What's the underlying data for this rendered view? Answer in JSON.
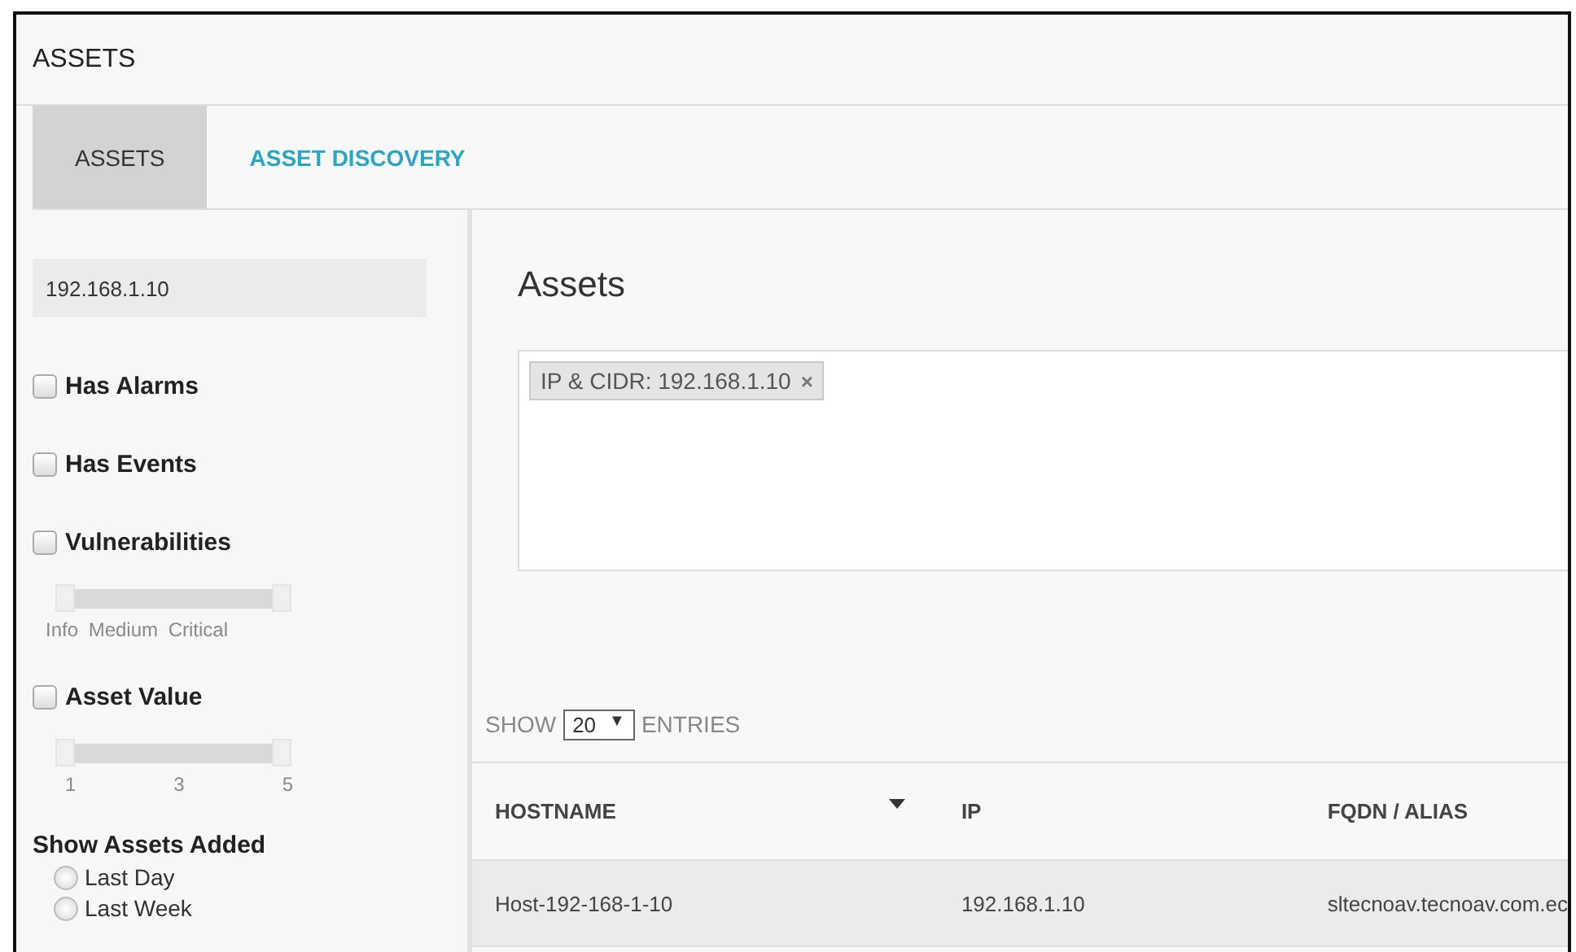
{
  "window": {
    "title": "ASSETS"
  },
  "tabs": [
    {
      "label": "ASSETS",
      "selected": true
    },
    {
      "label": "ASSET DISCOVERY",
      "selected": false
    }
  ],
  "sidebar": {
    "search": {
      "value": "192.168.1.10"
    },
    "filters": [
      {
        "kind": "checkbox",
        "label": "Has Alarms",
        "checked": false
      },
      {
        "kind": "checkbox",
        "label": "Has Events",
        "checked": false
      },
      {
        "kind": "slider",
        "label": "Vulnerabilities",
        "checked": false,
        "level": 1,
        "ticks": [
          "Info",
          "Medium",
          "Critical"
        ]
      },
      {
        "kind": "slider",
        "label": "Asset Value",
        "checked": false,
        "level": 1,
        "ticks": [
          "1",
          "3",
          "5"
        ]
      }
    ],
    "added": {
      "title": "Show Assets Added",
      "options": [
        {
          "label": "Last Day",
          "selected": false
        },
        {
          "label": "Last Week",
          "selected": false
        }
      ]
    }
  },
  "main": {
    "title": "Assets",
    "tags": [
      {
        "label": "IP & CIDR: 192.168.1.10",
        "remove": "×"
      }
    ],
    "entries": {
      "before": "SHOW",
      "value": "20",
      "caret": "▼",
      "after": "ENTRIES"
    },
    "table": {
      "columns": [
        {
          "label": "HOSTNAME",
          "sorted": true
        },
        {
          "label": "IP",
          "sorted": false
        },
        {
          "label": "FQDN / ALIAS",
          "sorted": false
        }
      ],
      "rows": [
        {
          "cells": [
            "Host-192-168-1-10",
            "192.168.1.10",
            "sltecnoav.tecnoav.com.ec"
          ],
          "selected": true
        }
      ]
    }
  }
}
